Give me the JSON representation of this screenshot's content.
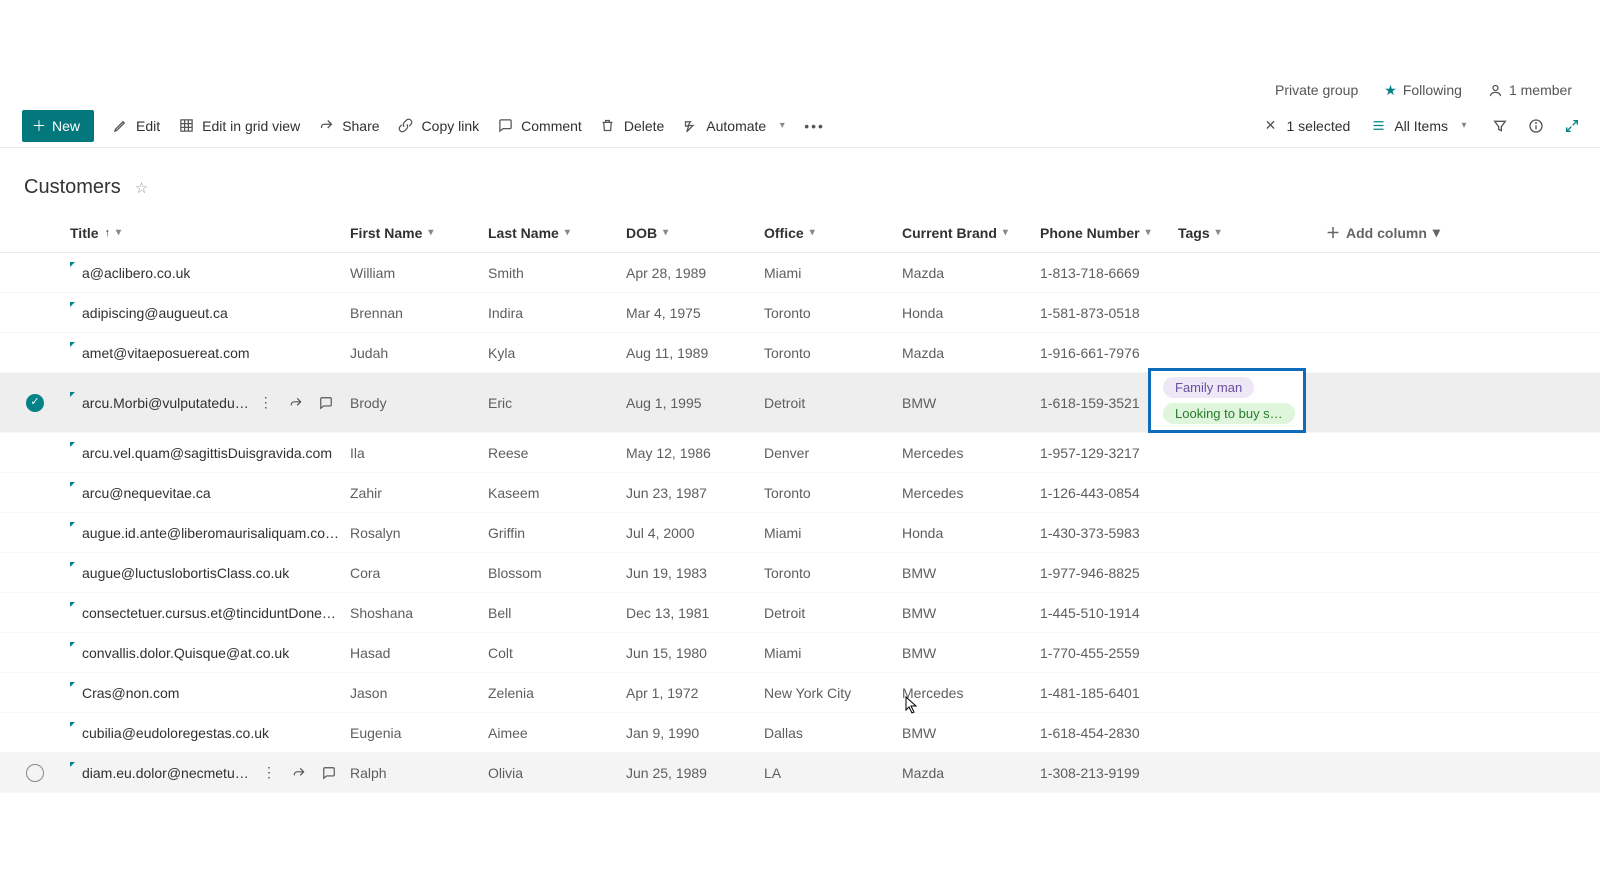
{
  "status": {
    "privacy": "Private group",
    "following": "Following",
    "members": "1 member"
  },
  "commands": {
    "new": "New",
    "edit": "Edit",
    "edit_grid": "Edit in grid view",
    "share": "Share",
    "copy_link": "Copy link",
    "comment": "Comment",
    "delete": "Delete",
    "automate": "Automate",
    "selected": "1 selected",
    "all_items": "All Items"
  },
  "list": {
    "title": "Customers"
  },
  "columns": {
    "title": "Title",
    "first_name": "First Name",
    "last_name": "Last Name",
    "dob": "DOB",
    "office": "Office",
    "current_brand": "Current Brand",
    "phone": "Phone Number",
    "tags": "Tags",
    "add": "Add column"
  },
  "rows": [
    {
      "title": "a@aclibero.co.uk",
      "first": "William",
      "last": "Smith",
      "dob": "Apr 28, 1989",
      "office": "Miami",
      "brand": "Mazda",
      "phone": "1-813-718-6669"
    },
    {
      "title": "adipiscing@augueut.ca",
      "first": "Brennan",
      "last": "Indira",
      "dob": "Mar 4, 1975",
      "office": "Toronto",
      "brand": "Honda",
      "phone": "1-581-873-0518"
    },
    {
      "title": "amet@vitaeposuereat.com",
      "first": "Judah",
      "last": "Kyla",
      "dob": "Aug 11, 1989",
      "office": "Toronto",
      "brand": "Mazda",
      "phone": "1-916-661-7976"
    },
    {
      "title": "arcu.Morbi@vulputatedu…",
      "first": "Brody",
      "last": "Eric",
      "dob": "Aug 1, 1995",
      "office": "Detroit",
      "brand": "BMW",
      "phone": "1-618-159-3521",
      "selected": true,
      "tags": [
        "Family man",
        "Looking to buy s…"
      ]
    },
    {
      "title": "arcu.vel.quam@sagittisDuisgravida.com",
      "first": "Ila",
      "last": "Reese",
      "dob": "May 12, 1986",
      "office": "Denver",
      "brand": "Mercedes",
      "phone": "1-957-129-3217"
    },
    {
      "title": "arcu@nequevitae.ca",
      "first": "Zahir",
      "last": "Kaseem",
      "dob": "Jun 23, 1987",
      "office": "Toronto",
      "brand": "Mercedes",
      "phone": "1-126-443-0854"
    },
    {
      "title": "augue.id.ante@liberomaurisaliquam.co.uk",
      "first": "Rosalyn",
      "last": "Griffin",
      "dob": "Jul 4, 2000",
      "office": "Miami",
      "brand": "Honda",
      "phone": "1-430-373-5983"
    },
    {
      "title": "augue@luctuslobortisClass.co.uk",
      "first": "Cora",
      "last": "Blossom",
      "dob": "Jun 19, 1983",
      "office": "Toronto",
      "brand": "BMW",
      "phone": "1-977-946-8825"
    },
    {
      "title": "consectetuer.cursus.et@tinciduntDonec.co.uk",
      "first": "Shoshana",
      "last": "Bell",
      "dob": "Dec 13, 1981",
      "office": "Detroit",
      "brand": "BMW",
      "phone": "1-445-510-1914"
    },
    {
      "title": "convallis.dolor.Quisque@at.co.uk",
      "first": "Hasad",
      "last": "Colt",
      "dob": "Jun 15, 1980",
      "office": "Miami",
      "brand": "BMW",
      "phone": "1-770-455-2559"
    },
    {
      "title": "Cras@non.com",
      "first": "Jason",
      "last": "Zelenia",
      "dob": "Apr 1, 1972",
      "office": "New York City",
      "brand": "Mercedes",
      "phone": "1-481-185-6401"
    },
    {
      "title": "cubilia@eudoloregestas.co.uk",
      "first": "Eugenia",
      "last": "Aimee",
      "dob": "Jan 9, 1990",
      "office": "Dallas",
      "brand": "BMW",
      "phone": "1-618-454-2830"
    },
    {
      "title": "diam.eu.dolor@necmetus.…",
      "first": "Ralph",
      "last": "Olivia",
      "dob": "Jun 25, 1989",
      "office": "LA",
      "brand": "Mazda",
      "phone": "1-308-213-9199",
      "hovered": true
    }
  ]
}
